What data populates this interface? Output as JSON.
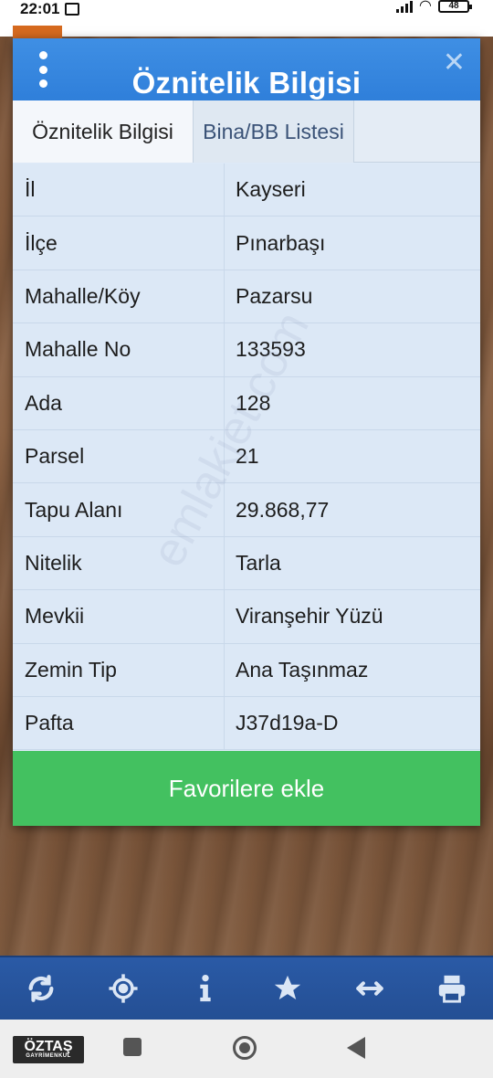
{
  "status_bar": {
    "time": "22:01",
    "battery": "48"
  },
  "dialog": {
    "title": "Öznitelik Bilgisi",
    "tabs": [
      {
        "label": "Öznitelik Bilgisi",
        "active": true
      },
      {
        "label": "Bina/BB Listesi",
        "active": false
      }
    ],
    "rows": [
      {
        "key": "İl",
        "value": "Kayseri"
      },
      {
        "key": "İlçe",
        "value": "Pınarbaşı"
      },
      {
        "key": "Mahalle/Köy",
        "value": "Pazarsu"
      },
      {
        "key": "Mahalle No",
        "value": "133593"
      },
      {
        "key": "Ada",
        "value": "128"
      },
      {
        "key": "Parsel",
        "value": "21"
      },
      {
        "key": "Tapu Alanı",
        "value": "29.868,77"
      },
      {
        "key": "Nitelik",
        "value": "Tarla"
      },
      {
        "key": "Mevkii",
        "value": "Viranşehir Yüzü"
      },
      {
        "key": "Zemin Tip",
        "value": "Ana Taşınmaz"
      },
      {
        "key": "Pafta",
        "value": "J37d19a-D"
      }
    ],
    "favorite_label": "Favorilere ekle"
  },
  "toolbar": {
    "icons": [
      "refresh-icon",
      "locate-icon",
      "info-icon",
      "star-icon",
      "swap-arrows-icon",
      "print-icon"
    ]
  },
  "brand": {
    "name": "ÖZTAŞ",
    "tagline": "GAYRİMENKUL"
  },
  "watermark": "emlakjet.com",
  "colors": {
    "header_blue": "#3f8fe4",
    "favorite_green": "#43c160",
    "toolbar_blue": "#2a5aa6"
  }
}
